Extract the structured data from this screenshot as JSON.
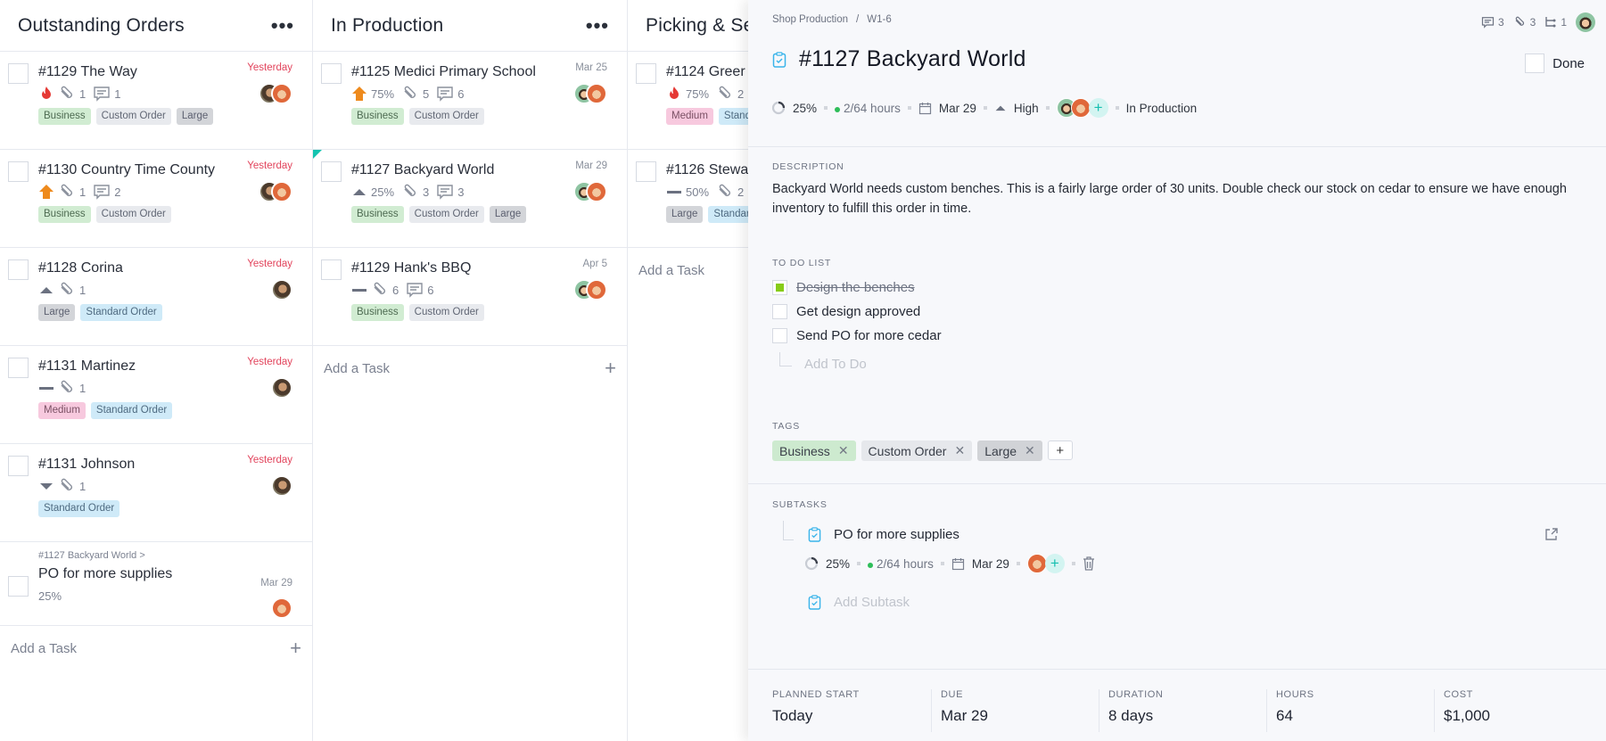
{
  "board": {
    "columns": [
      {
        "title": "Outstanding Orders",
        "more": "•••",
        "cards": [
          {
            "title": "#1129 The Way",
            "priority": "urgent",
            "attachments": "1",
            "comments": "1",
            "due": "Yesterday",
            "tags": [
              "Business",
              "Custom Order",
              "Large"
            ]
          },
          {
            "title": "#1130 Country Time County",
            "priority": "high",
            "attachments": "1",
            "comments": "2",
            "due": "Yesterday",
            "tags": [
              "Business",
              "Custom Order"
            ]
          },
          {
            "title": "#1128 Corina",
            "priority": "medium-high",
            "attachments": "1",
            "due": "Yesterday",
            "tags": [
              "Large",
              "Standard Order"
            ]
          },
          {
            "title": "#1131 Martinez",
            "priority": "normal",
            "attachments": "1",
            "due": "Yesterday",
            "tags": [
              "Medium",
              "Standard Order"
            ]
          },
          {
            "title": "#1131 Johnson",
            "priority": "low",
            "attachments": "1",
            "due": "Yesterday",
            "tags": [
              "Standard Order"
            ]
          },
          {
            "parent": "#1127 Backyard World >",
            "title": "PO for more supplies",
            "progress": "25%",
            "due": "Mar 29"
          }
        ],
        "add_task": "Add a Task"
      },
      {
        "title": "In Production",
        "more": "•••",
        "cards": [
          {
            "title": "#1125 Medici Primary School",
            "priority": "high",
            "progress": "75%",
            "attachments": "5",
            "comments": "6",
            "due": "Mar 25",
            "tags": [
              "Business",
              "Custom Order"
            ]
          },
          {
            "title": "#1127 Backyard World",
            "priority": "medium-high",
            "progress": "25%",
            "attachments": "3",
            "comments": "3",
            "due": "Mar 29",
            "tags": [
              "Business",
              "Custom Order",
              "Large"
            ],
            "selected": true
          },
          {
            "title": "#1129 Hank's BBQ",
            "priority": "normal",
            "attachments": "6",
            "comments": "6",
            "due": "Apr 5",
            "tags": [
              "Business",
              "Custom Order"
            ]
          }
        ],
        "add_task": "Add a Task"
      },
      {
        "title": "Picking & Se",
        "cards": [
          {
            "title": "#1124 Greer",
            "priority": "urgent",
            "progress": "75%",
            "attachments": "2",
            "tags": [
              "Medium",
              "Stand"
            ]
          },
          {
            "title": "#1126 Stewa",
            "priority": "normal",
            "progress": "50%",
            "attachments": "2",
            "tags": [
              "Large",
              "Standar"
            ]
          }
        ],
        "add_task": "Add a Task"
      }
    ]
  },
  "detail": {
    "breadcrumb": [
      "Shop Production",
      "/",
      "W1-6"
    ],
    "counts": {
      "comments": "3",
      "attachments": "3",
      "subtasks": "1"
    },
    "title": "#1127 Backyard World",
    "done_label": "Done",
    "meta": {
      "progress": "25%",
      "hours": "2/64 hours",
      "due": "Mar 29",
      "priority": "High",
      "status": "In Production"
    },
    "description_label": "DESCRIPTION",
    "description": "Backyard World needs custom benches. This is a fairly large order of 30 units. Double check our stock on cedar to ensure we have enough inventory to fulfill this order in time.",
    "todo_label": "TO DO LIST",
    "todos": [
      {
        "text": "Design the benches",
        "done": true
      },
      {
        "text": "Get design approved",
        "done": false
      },
      {
        "text": "Send PO for more cedar",
        "done": false
      }
    ],
    "add_todo": "Add To Do",
    "tags_label": "TAGS",
    "tags": [
      "Business",
      "Custom Order",
      "Large"
    ],
    "tag_add": "+",
    "subtasks_label": "SUBTASKS",
    "subtask": {
      "title": "PO for more supplies",
      "progress": "25%",
      "hours": "2/64 hours",
      "due": "Mar 29"
    },
    "add_subtask": "Add Subtask",
    "footer": [
      {
        "label": "PLANNED START",
        "value": "Today"
      },
      {
        "label": "DUE",
        "value": "Mar 29"
      },
      {
        "label": "DURATION",
        "value": "8 days"
      },
      {
        "label": "HOURS",
        "value": "64"
      },
      {
        "label": "COST",
        "value": "$1,000"
      }
    ]
  },
  "colors": {
    "accent": "#14c4b0",
    "late": "#e2445c",
    "todo_check": "#87cc18",
    "hours_dot": "#2ebd59",
    "task_icon": "#3ab4ea"
  }
}
